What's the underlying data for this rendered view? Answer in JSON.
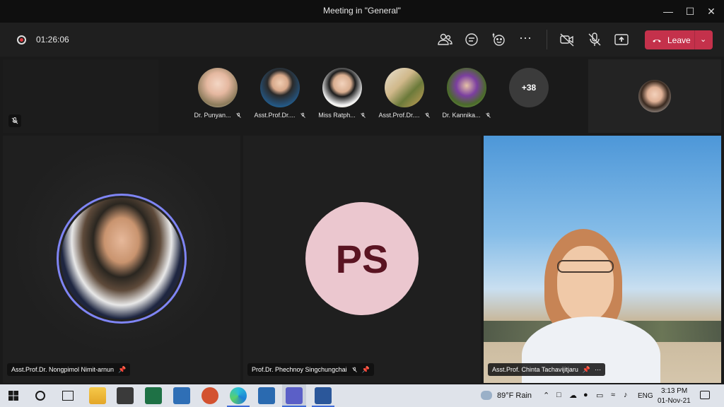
{
  "window": {
    "title": "Meeting in \"General\""
  },
  "toolbar": {
    "timer": "01:26:06",
    "leave_label": "Leave"
  },
  "strip": {
    "participants": [
      {
        "name": "Dr. Punyan..."
      },
      {
        "name": "Asst.Prof.Dr...."
      },
      {
        "name": "Miss Ratph..."
      },
      {
        "name": "Asst.Prof.Dr...."
      },
      {
        "name": "Dr. Kannika..."
      }
    ],
    "more_count": "+38"
  },
  "stage": {
    "tile1_name": "Asst.Prof.Dr. Nongpimol Nimit-arnun",
    "tile2_initials": "PS",
    "tile2_name": "Prof.Dr. Phechnoy Singchungchai",
    "tile3_name": "Asst.Prof. Chinta Tachavijitjaru"
  },
  "taskbar": {
    "weather": "89°F  Rain",
    "lang": "ENG",
    "time": "3:13 PM",
    "date": "01-Nov-21"
  },
  "colors": {
    "leave": "#c4314b",
    "avatar_ring": "#7f85f5",
    "ps_bg": "#ebc7cf",
    "ps_text": "#5a1422"
  }
}
